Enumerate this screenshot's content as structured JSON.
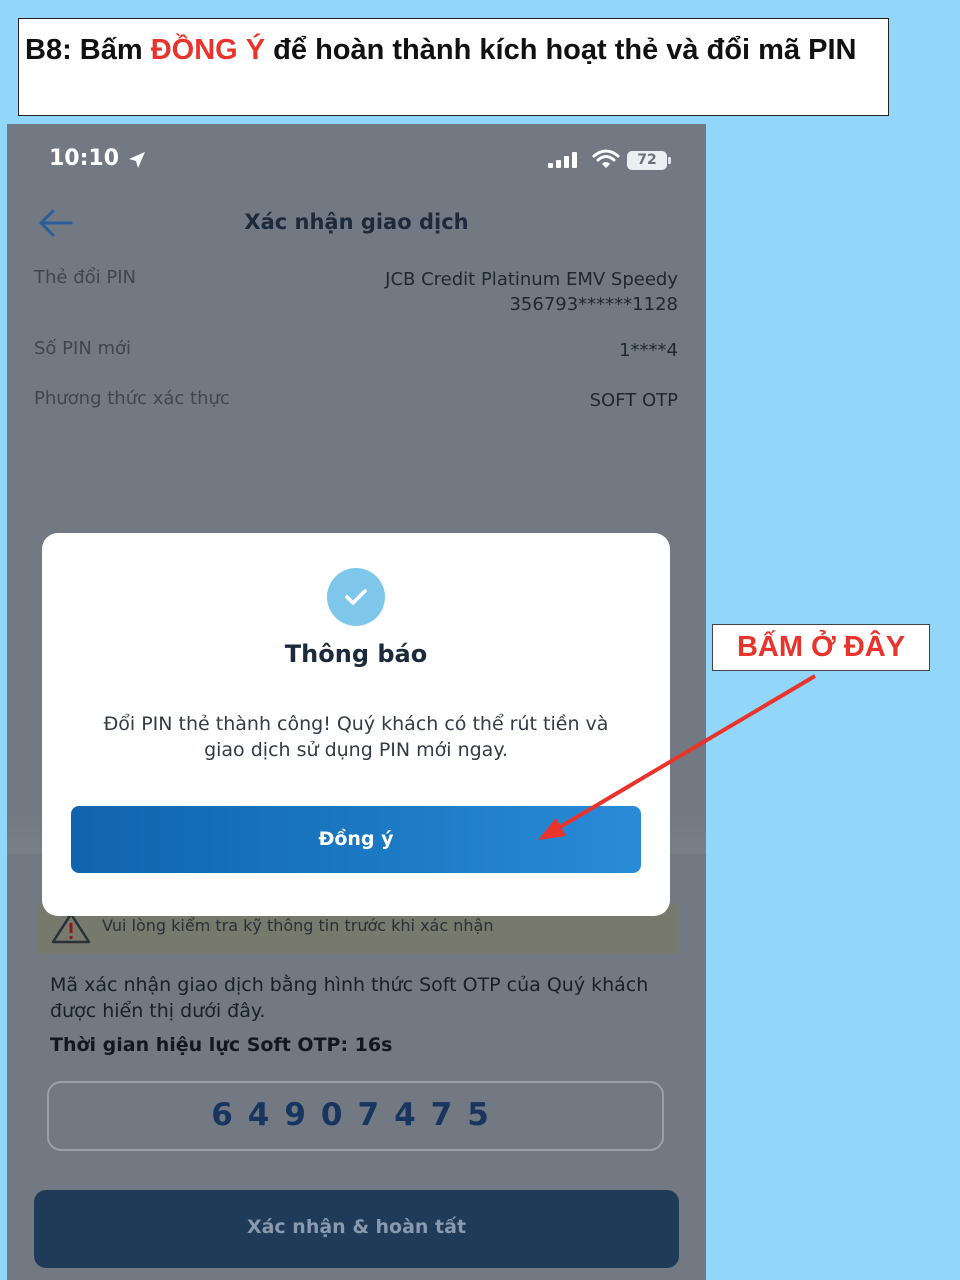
{
  "banner": {
    "prefix": "B8: Bấm ",
    "highlight": "ĐỒNG Ý",
    "suffix": " để hoàn thành kích hoạt thẻ và đổi mã PIN"
  },
  "status_bar": {
    "time": "10:10",
    "battery": "72"
  },
  "header": {
    "title": "Xác nhận giao dịch"
  },
  "details": [
    {
      "label": "Thẻ đổi PIN",
      "value_line1": "JCB Credit Platinum EMV Speedy",
      "value_line2": "356793******1128"
    },
    {
      "label": "Số PIN mới",
      "value": "1****4"
    },
    {
      "label": "Phương thức xác thực",
      "value": "SOFT OTP"
    }
  ],
  "warning": {
    "text": "Vui lòng kiểm tra kỹ thông tin trước khi xác nhận"
  },
  "otp": {
    "description": "Mã xác nhận giao dịch bằng hình thức Soft OTP của Quý khách được hiển thị dưới đây.",
    "timer": "Thời gian hiệu lực Soft OTP:  16s",
    "code": "64907475"
  },
  "confirm_button": "Xác nhận & hoàn tất",
  "dialog": {
    "title": "Thông báo",
    "message": "Đổi PIN thẻ thành công! Quý khách có thể rút tiền và giao dịch sử dụng PIN mới ngay.",
    "ok_label": "Đồng ý"
  },
  "callout": {
    "text": "BẤM Ở ĐÂY"
  },
  "colors": {
    "page_background": "#92d7f9",
    "highlight_red": "#e8342c",
    "primary_blue": "#1c79c4",
    "overlay_gray": "#727982"
  }
}
